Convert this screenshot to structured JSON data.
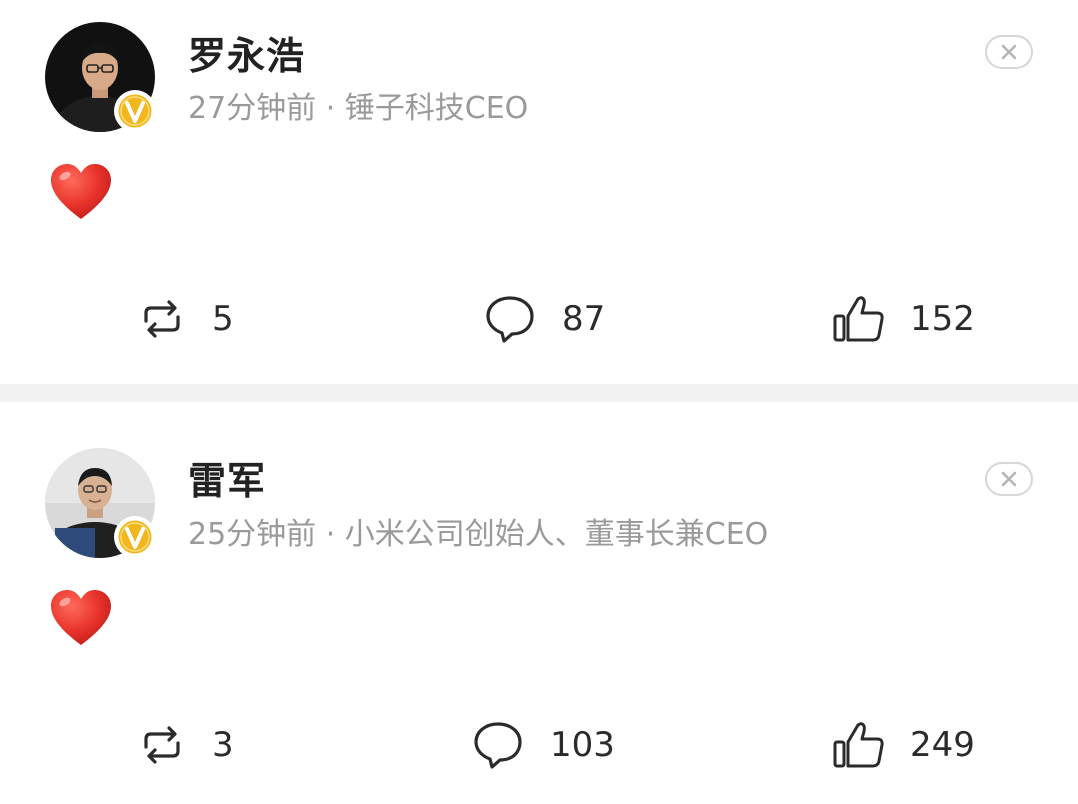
{
  "posts": [
    {
      "author": "罗永浩",
      "meta": "27分钟前 · 锤子科技CEO",
      "content_icon": "red-heart-emoji",
      "counts": {
        "repost": "5",
        "comment": "87",
        "like": "152"
      }
    },
    {
      "author": "雷军",
      "meta": "25分钟前 · 小米公司创始人、董事长兼CEO",
      "content_icon": "red-heart-emoji",
      "counts": {
        "repost": "3",
        "comment": "103",
        "like": "249"
      }
    }
  ],
  "icons": {
    "repost": "repost-icon",
    "comment": "comment-icon",
    "like": "thumbs-up-icon",
    "close": "close-icon",
    "verified": "verified-v-badge-icon"
  },
  "colors": {
    "heart": "#e8322b",
    "verified_badge": "#f1b71c",
    "meta_text": "#9a9a9a",
    "separator": "#f2f2f2"
  }
}
